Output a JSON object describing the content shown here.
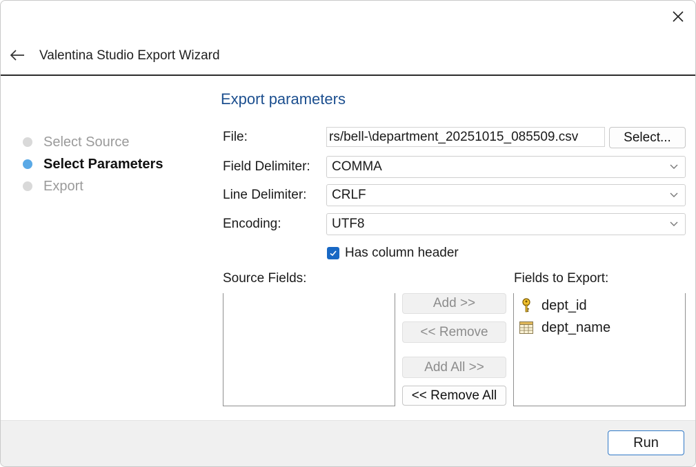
{
  "window": {
    "title": "Valentina Studio Export Wizard"
  },
  "steps": [
    {
      "label": "Select Source",
      "state": "done"
    },
    {
      "label": "Select Parameters",
      "state": "active"
    },
    {
      "label": "Export",
      "state": "todo"
    }
  ],
  "params": {
    "title": "Export parameters",
    "file_label": "File:",
    "file_value": "rs/bell-\\department_20251015_085509.csv",
    "select_button": "Select...",
    "field_delimiter_label": "Field Delimiter:",
    "field_delimiter_value": "COMMA",
    "line_delimiter_label": "Line Delimiter:",
    "line_delimiter_value": "CRLF",
    "encoding_label": "Encoding:",
    "encoding_value": "UTF8",
    "has_header_label": "Has column header",
    "has_header_checked": true
  },
  "fields": {
    "source_label": "Source Fields:",
    "export_label": "Fields to Export:",
    "source_items": [],
    "export_items": [
      {
        "name": "dept_id",
        "icon": "key-icon"
      },
      {
        "name": "dept_name",
        "icon": "table-field-icon"
      }
    ],
    "add_button": "Add >>",
    "remove_button": "<< Remove",
    "add_all_button": "Add All >>",
    "remove_all_button": "<< Remove All"
  },
  "footer": {
    "run_button": "Run"
  },
  "colors": {
    "accent": "#1868c4",
    "section_title": "#1c4f8f",
    "active_dot": "#5aa9e6"
  }
}
